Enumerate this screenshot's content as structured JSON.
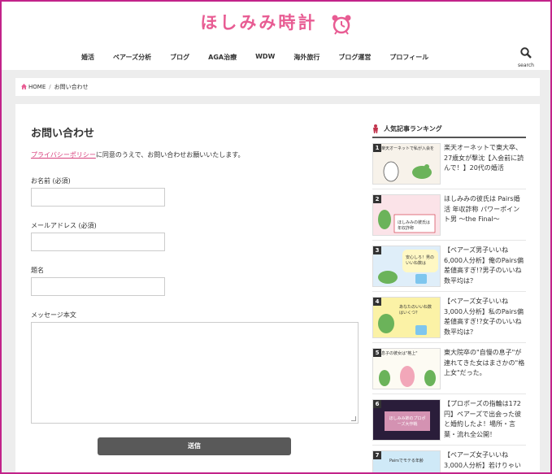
{
  "site": {
    "logo": "ほしみみ時計"
  },
  "nav": {
    "items": [
      "婚活",
      "ペアーズ分析",
      "ブログ",
      "AGA治療",
      "WDW",
      "海外旅行",
      "ブログ運営",
      "プロフィール"
    ],
    "search_label": "search"
  },
  "breadcrumb": {
    "home": "HOME",
    "current": "お問い合わせ"
  },
  "form": {
    "title": "お問い合わせ",
    "intro_link": "プライバシーポリシー",
    "intro_text": "に同意のうえで、お問い合わせお願いいたします。",
    "name_label": "お名前 (必須)",
    "email_label": "メールアドレス (必須)",
    "subject_label": "題名",
    "message_label": "メッセージ本文",
    "submit_label": "送信"
  },
  "sidebar": {
    "title": "人気記事ランキング",
    "items": [
      {
        "rank": "1",
        "thumb_text": "楽天オーネットで私が入会を",
        "title": "楽天オーネットで東大卒、27歳女が撃沈【入会前に読んで！】20代の婚活"
      },
      {
        "rank": "2",
        "thumb_text": "ほしみみの彼氏は年収詐称",
        "title": "ほしみみの彼氏は Pairs婚活 年収詐称 パワーポイント男 〜the Final〜"
      },
      {
        "rank": "3",
        "thumb_text": "安心しろ！男のいいね数は",
        "title": "【ペアーズ男子いいね6,000人分析】俺のPairs偏差値高すぎ!?男子のいいね数平均は？"
      },
      {
        "rank": "4",
        "thumb_text": "あなたのいいね数はいくつ？",
        "title": "【ペアーズ女子いいね3,000人分析】私のPairs偏差値高すぎ!?女子のいいね数平均は？"
      },
      {
        "rank": "5",
        "thumb_text": "息子の彼女は\"格上\"",
        "title": "東大院卒の\"自慢の息子\"が連れてきた女はまさかの\"格上女\"だった。"
      },
      {
        "rank": "6",
        "thumb_text": "ほしみみ姉のプロポーズ大作戦",
        "title": "【プロポーズの指輪は172円】ペアーズで出会った彼と婚約したよ！場所・言葉・流れ全公開！"
      },
      {
        "rank": "7",
        "thumb_text": "Pairsでモテる年齢",
        "title": "【ペアーズ女子いいね3,000人分析】若けりゃいい"
      }
    ]
  },
  "colors": {
    "brand": "#e85c93",
    "frame": "#c2238a",
    "button": "#595959"
  }
}
